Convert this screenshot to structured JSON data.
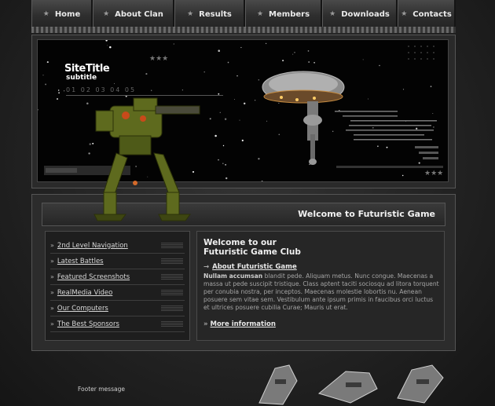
{
  "nav": {
    "items": [
      {
        "label": "Home",
        "width": 78
      },
      {
        "label": "About Clan",
        "width": 104
      },
      {
        "label": "Results",
        "width": 90
      },
      {
        "label": "Members",
        "width": 98
      },
      {
        "label": "Downloads",
        "width": 96
      },
      {
        "label": "Contacts",
        "width": 74
      }
    ]
  },
  "header": {
    "site_title": "SiteTitle",
    "site_subtitle": "subtitle",
    "steps": "01 02 03 04 05"
  },
  "welcome": {
    "bar_title": "Welcome to Futuristic Game"
  },
  "sidebar": {
    "items": [
      {
        "label": "2nd Level Navigation"
      },
      {
        "label": "Latest Battles"
      },
      {
        "label": "Featured Screenshots"
      },
      {
        "label": "RealMedia Video"
      },
      {
        "label": "Our Computers"
      },
      {
        "label": "The Best Sponsors"
      }
    ]
  },
  "content": {
    "heading_line1": "Welcome to our",
    "heading_line2": "Futuristic Game Club",
    "about_link": "About Futuristic Game",
    "lead": "Nullam accumsan",
    "body": "blandit pede. Aliquam metus. Nunc congue. Maecenas a massa ut pede suscipit tristique. Class aptent taciti sociosqu ad litora torquent per conubia nostra, per inceptos. Maecenas molestie lobortis nu. Aenean posuere sem vitae sem. Vestibulum ante ipsum primis in faucibus orci luctus et ultrices posuere cubilia Curae; Mauris ut erat.",
    "more_link": "More information"
  },
  "footer": {
    "message": "Footer message"
  },
  "colors": {
    "background": "#1b1b1b",
    "panel": "#262626",
    "text_light": "#f0f0f0",
    "text_muted": "#a5a5a5"
  }
}
